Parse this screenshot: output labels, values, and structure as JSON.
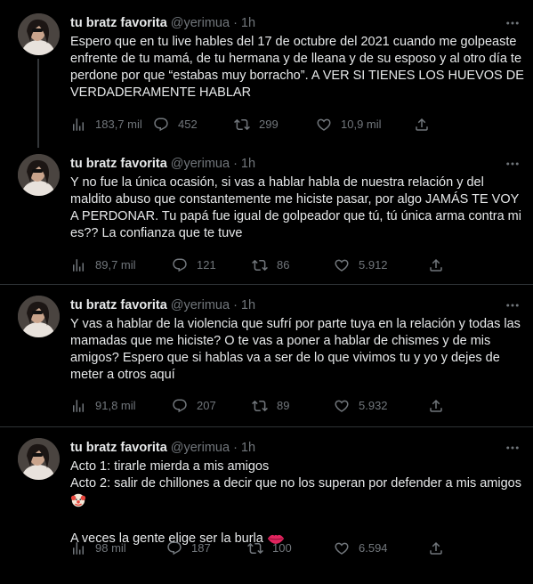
{
  "tweets": [
    {
      "name": "tu bratz favorita",
      "handle": "@yerimua",
      "dot": "·",
      "time": "1h",
      "text_lines": [
        "Espero que en tu live hables del 17 de octubre del 2021 cuando me golpeaste enfrente de tu mamá, de tu hermana y de lleana y de su esposo y al otro día te perdone por que “estabas muy borracho”. A VER SI TIENES LOS HUEVOS DE VERDADERAMENTE HABLAR"
      ],
      "views": "183,7 mil",
      "replies": "452",
      "retweets": "299",
      "likes": "10,9 mil"
    },
    {
      "name": "tu bratz favorita",
      "handle": "@yerimua",
      "dot": "·",
      "time": "1h",
      "text_lines": [
        "Y no fue la única ocasión, si vas a hablar habla de nuestra relación y del maldito abuso que constantemente me hiciste pasar, por algo JAMÁS TE VOY A PERDONAR. Tu papá fue igual de golpeador que tú, tú única arma contra mi es?? La confianza que te tuve"
      ],
      "views": "89,7 mil",
      "replies": "121",
      "retweets": "86",
      "likes": "5.912"
    },
    {
      "name": "tu bratz favorita",
      "handle": "@yerimua",
      "dot": "·",
      "time": "1h",
      "text_lines": [
        "Y vas a hablar de la violencia que sufrí por parte tuya en la relación y todas las mamadas que me hiciste? O te vas a poner a hablar de chismes y de mis amigos? Espero que si hablas va a ser de lo que vivimos tu y yo y dejes de meter a otros aquí"
      ],
      "views": "91,8 mil",
      "replies": "207",
      "retweets": "89",
      "likes": "5.932"
    },
    {
      "name": "tu bratz favorita",
      "handle": "@yerimua",
      "dot": "·",
      "time": "1h",
      "text_lines": [
        "Acto 1: tirarle mierda a mis amigos",
        "Acto 2: salir de chillones a decir que no los superan por defender a mis amigos",
        "",
        "A veces la gente elige ser la burla"
      ],
      "emoji_1": "clown-face",
      "emoji_2": "lips-kiss",
      "views": "98 mil",
      "replies": "187",
      "retweets": "100",
      "likes": "6.594"
    }
  ],
  "icons": {
    "more": "more-dots-icon",
    "views": "views-chart-icon",
    "reply": "reply-bubble-icon",
    "retweet": "retweet-arrows-icon",
    "like": "heart-icon",
    "share": "share-upload-icon"
  },
  "colors": {
    "background": "#000000",
    "text": "#e7e9ea",
    "muted": "#71767b",
    "border": "#2f3336"
  }
}
